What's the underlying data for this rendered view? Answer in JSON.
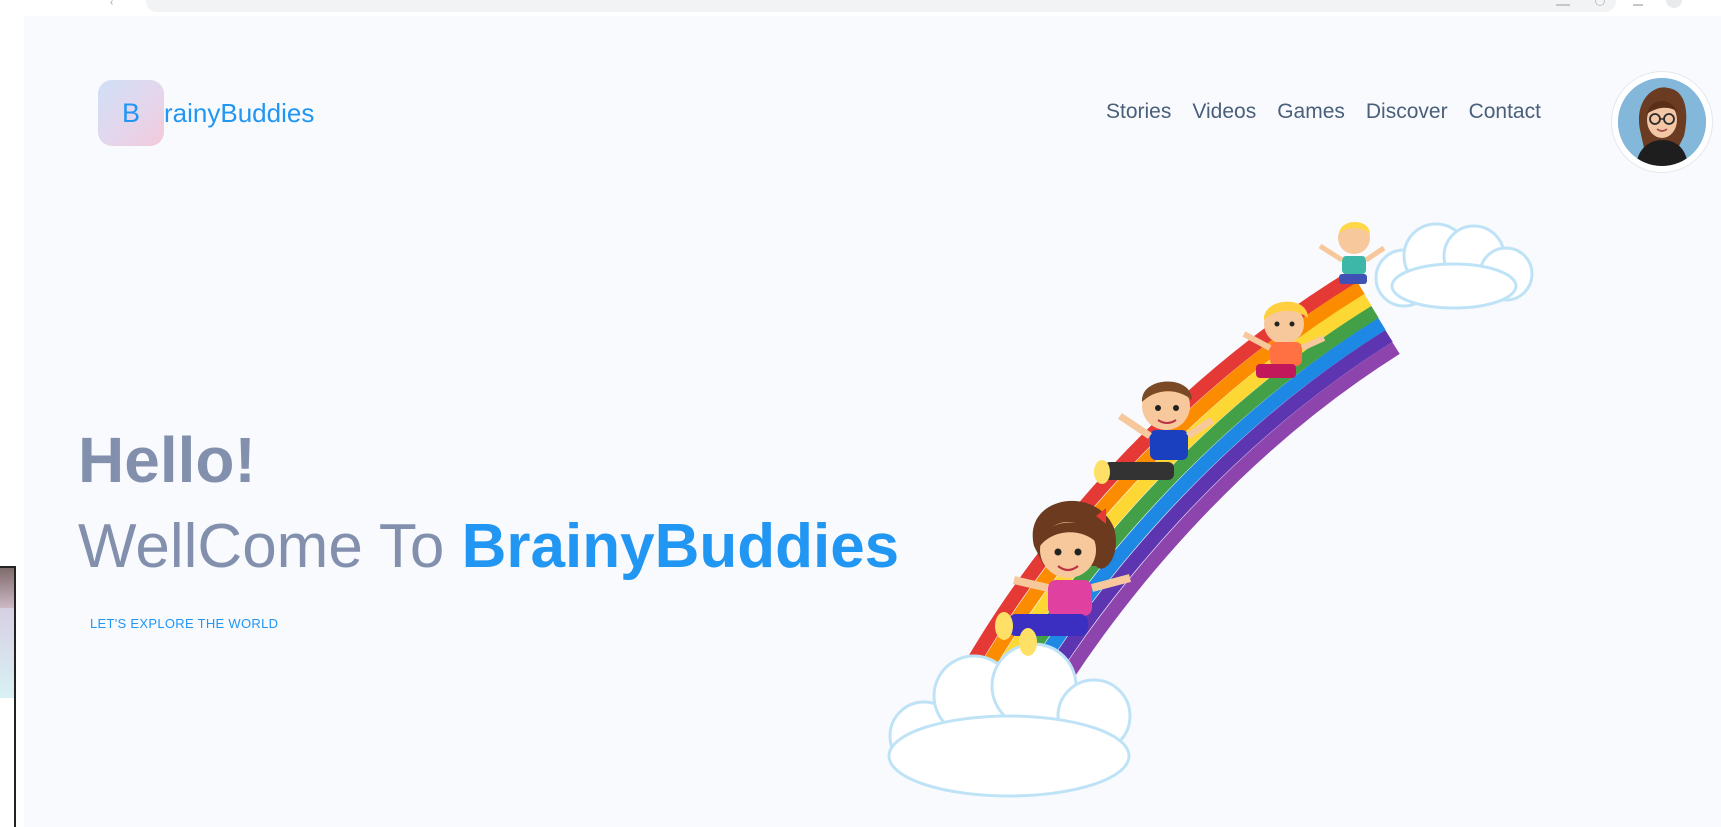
{
  "brand": {
    "logo_letter": "B",
    "name": "rainyBuddies",
    "accent_color": "#2196f3",
    "logo_gradient": [
      "#cfe0f7",
      "#f3c9da"
    ]
  },
  "nav": {
    "items": [
      {
        "label": "Stories"
      },
      {
        "label": "Videos"
      },
      {
        "label": "Games"
      },
      {
        "label": "Discover"
      },
      {
        "label": "Contact"
      }
    ],
    "text_color": "#4a5f7a"
  },
  "profile": {
    "icon": "user-avatar-icon"
  },
  "hero": {
    "greeting": "Hello!",
    "welcome_prefix": "WellCome To ",
    "welcome_brand": "BrainyBuddies",
    "tagline": "LET'S EXPLORE THE WORLD",
    "text_color": "#8290ad"
  },
  "illustration": {
    "icon": "rainbow-slide-kids-illustration"
  },
  "colors": {
    "page_background": "#f8fafd"
  }
}
